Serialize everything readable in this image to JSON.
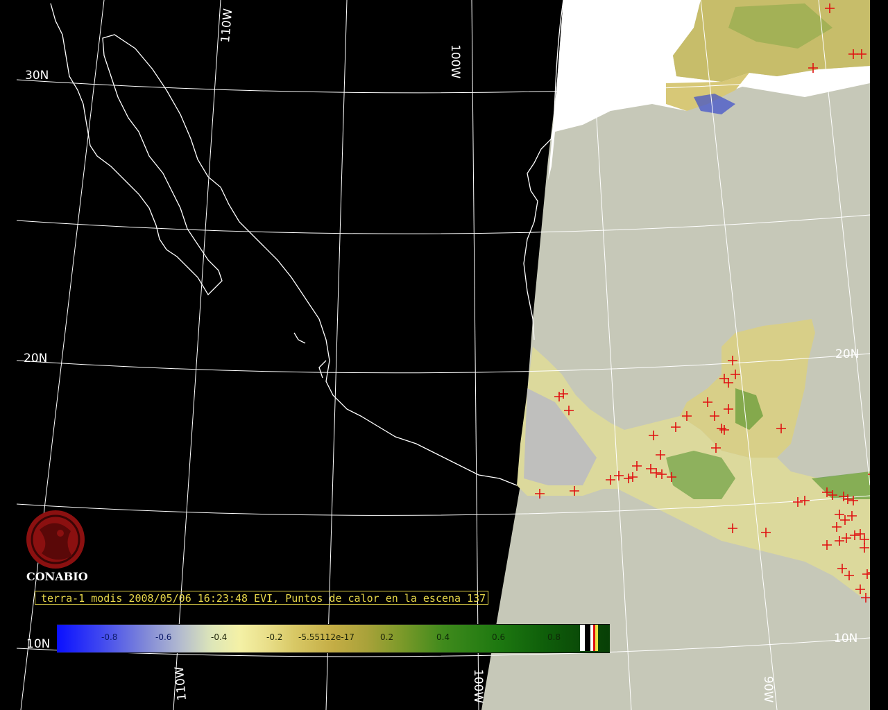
{
  "map": {
    "lat_labels": [
      "30N",
      "20N",
      "20N",
      "10N",
      "10N"
    ],
    "lon_labels": [
      "110W",
      "100W",
      "110W",
      "100W",
      "90W"
    ],
    "colors": {
      "ocean_gray": "#c6c8b8",
      "night_black": "#000000",
      "coastline": "#ffffff",
      "gridline": "#ffffff",
      "hotspot": "#e01010",
      "cloud_white": "#ffffff",
      "vegetation_yellow": "#dcd58a",
      "vegetation_green": "#3f8a1c"
    }
  },
  "logo": {
    "name": "CONABIO",
    "icon": "conabio-logo-icon"
  },
  "caption": {
    "text": "terra-1 modis 2008/05/06 16:23:48 EVI, Puntos de calor en la escena 137"
  },
  "colorbar": {
    "ticks": [
      "-0.8",
      "-0.6",
      "-0.4",
      "-0.2",
      "-5.55112e-17",
      "0.2",
      "0.4",
      "0.6",
      "0.8"
    ]
  }
}
